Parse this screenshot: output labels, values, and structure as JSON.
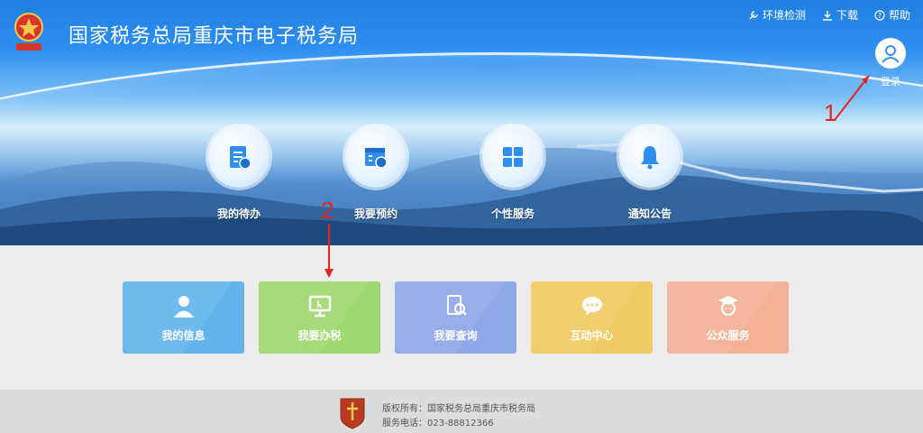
{
  "header": {
    "title": "国家税务总局重庆市电子税务局",
    "links": [
      {
        "label": "环境检测",
        "icon": "wrench-icon"
      },
      {
        "label": "下载",
        "icon": "download-icon"
      },
      {
        "label": "帮助",
        "icon": "help-icon"
      }
    ],
    "login_label": "登录"
  },
  "quick_actions": [
    {
      "label": "我的待办",
      "icon": "todo-list-icon"
    },
    {
      "label": "我要预约",
      "icon": "calendar-clock-icon"
    },
    {
      "label": "个性服务",
      "icon": "grid-icon"
    },
    {
      "label": "通知公告",
      "icon": "bell-icon"
    }
  ],
  "tiles": [
    {
      "label": "我的信息",
      "icon": "user-icon",
      "color": "#62b4ec"
    },
    {
      "label": "我要办税",
      "icon": "monitor-icon",
      "color": "#9ed86e"
    },
    {
      "label": "我要查询",
      "icon": "search-doc-icon",
      "color": "#8fa8ea"
    },
    {
      "label": "互动中心",
      "icon": "chat-icon",
      "color": "#f1cb62"
    },
    {
      "label": "公众服务",
      "icon": "graduate-icon",
      "color": "#f3b094"
    }
  ],
  "footer": {
    "copyright": "版权所有：国家税务总局重庆市税务局",
    "phone": "服务电话：023-88812366"
  },
  "annotations": {
    "one": "1",
    "two": "2"
  },
  "colors": {
    "accent": "#2f8ff0",
    "arrow": "#e32424"
  }
}
